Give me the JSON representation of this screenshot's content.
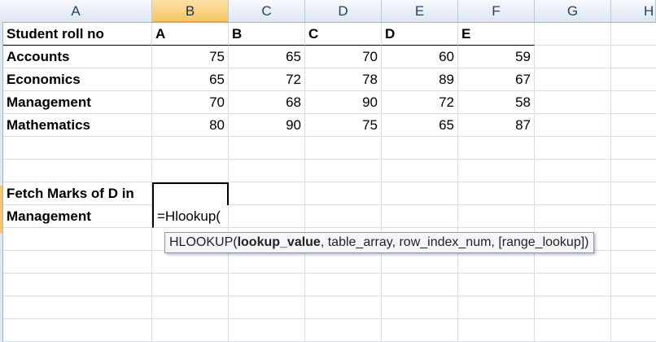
{
  "columns": [
    "A",
    "B",
    "C",
    "D",
    "E",
    "F",
    "G",
    "H"
  ],
  "header_row": {
    "label": "Student roll no",
    "cols": [
      "A",
      "B",
      "C",
      "D",
      "E"
    ]
  },
  "rows": [
    {
      "subject": "Accounts",
      "values": [
        "75",
        "65",
        "70",
        "60",
        "59"
      ]
    },
    {
      "subject": "Economics",
      "values": [
        "65",
        "72",
        "78",
        "89",
        "67"
      ]
    },
    {
      "subject": "Management",
      "values": [
        "70",
        "68",
        "90",
        "72",
        "58"
      ]
    },
    {
      "subject": "Mathematics",
      "values": [
        "80",
        "90",
        "75",
        "65",
        "87"
      ]
    }
  ],
  "query": {
    "line1": "Fetch Marks of D in",
    "line2": "Management",
    "formula": "=Hlookup("
  },
  "tooltip": {
    "fn": "HLOOKUP(",
    "arg_bold": "lookup_value",
    "rest": ", table_array, row_index_num, [range_lookup])"
  },
  "colors": {
    "selected_col_header": "#f5c566",
    "grid_line": "#d4dde8"
  }
}
